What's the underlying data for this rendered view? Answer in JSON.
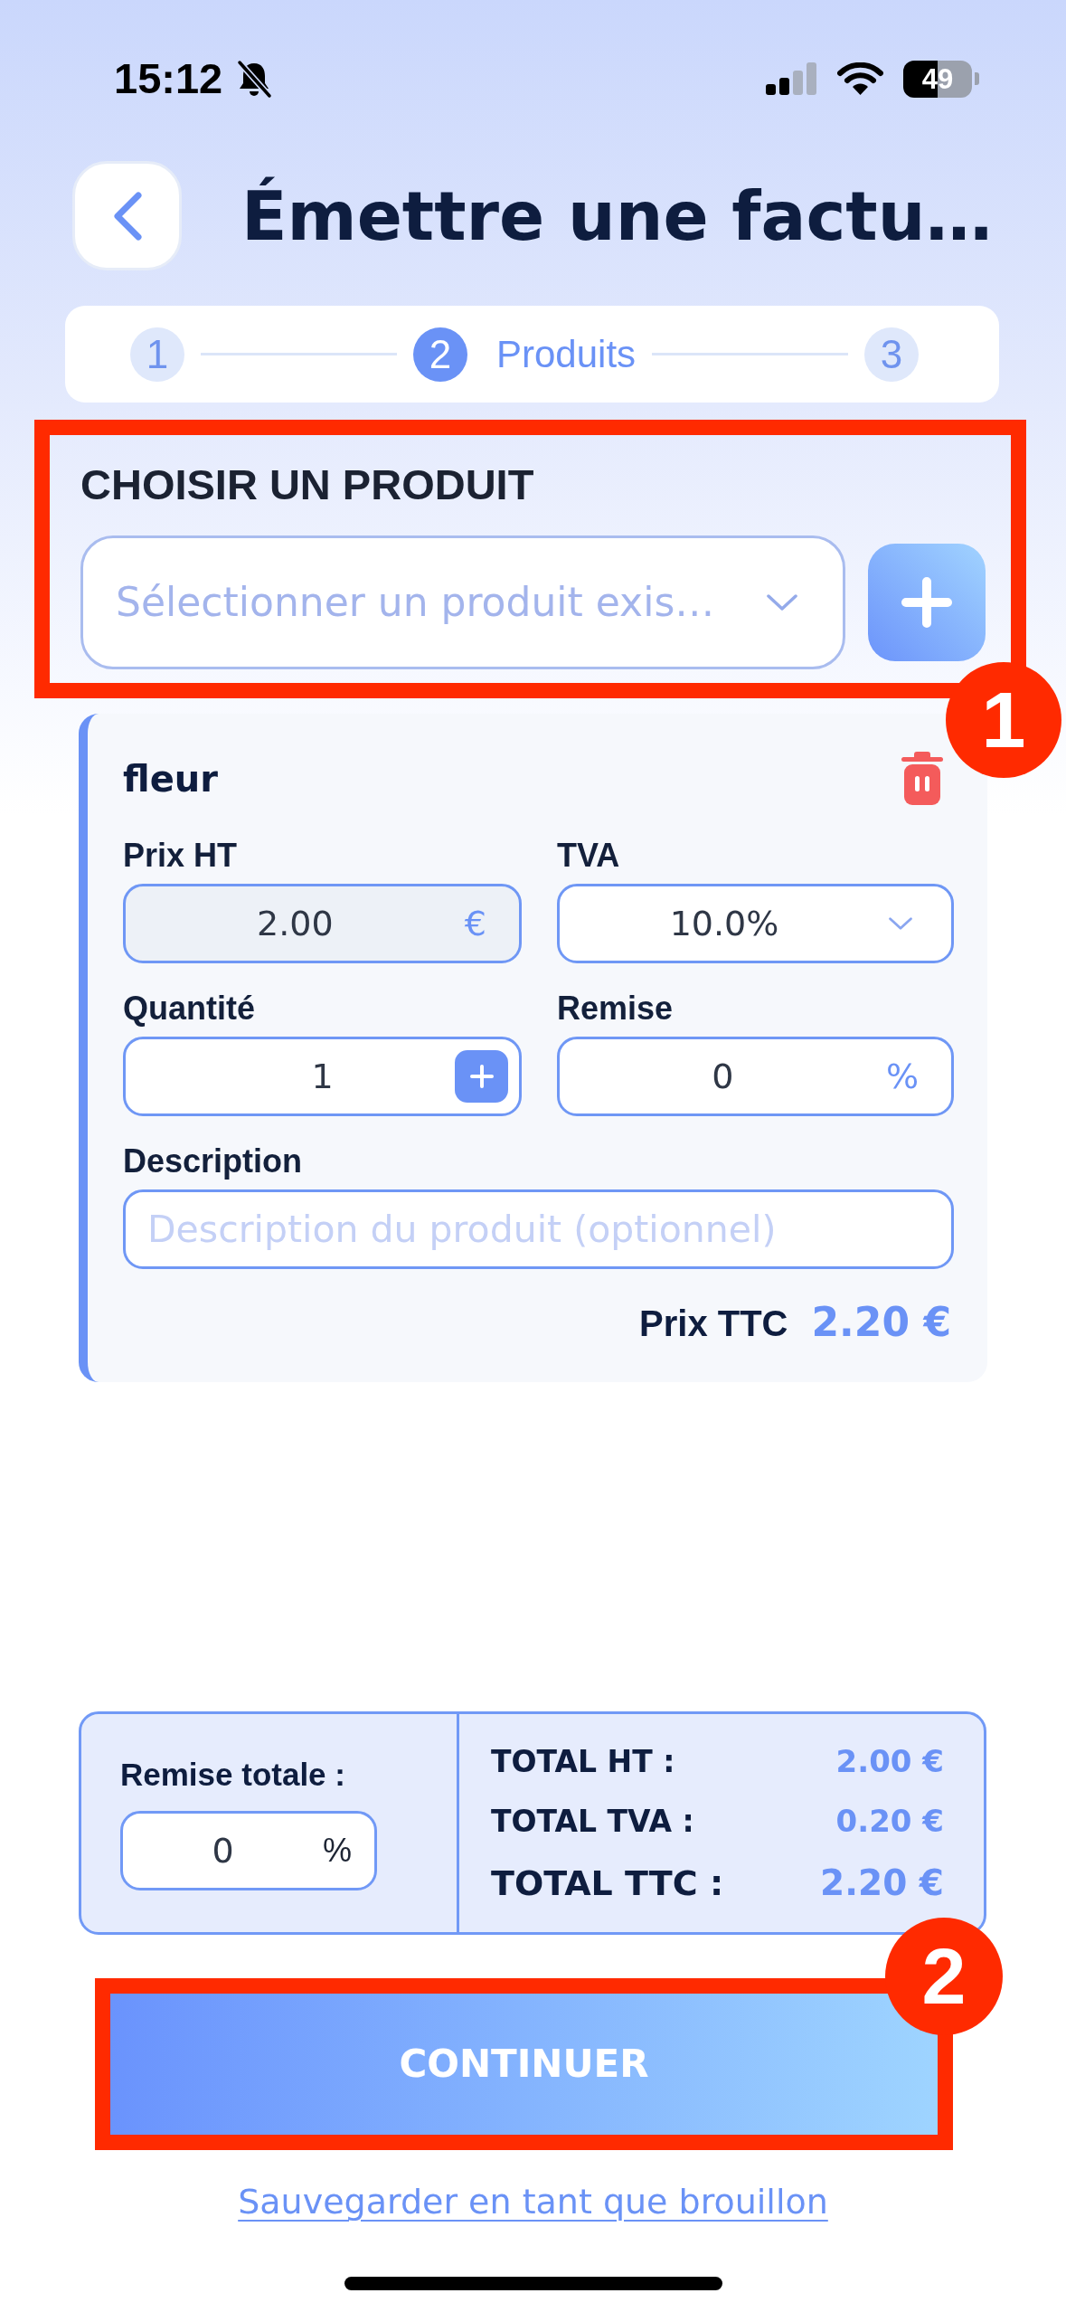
{
  "status_bar": {
    "time": "15:12",
    "battery": "49"
  },
  "header": {
    "title": "Émettre une factu…"
  },
  "stepper": [
    {
      "number": "1",
      "selected": false
    },
    {
      "number": "2",
      "label": "Produits",
      "selected": true
    },
    {
      "number": "3",
      "selected": false
    }
  ],
  "product_picker": {
    "heading": "CHOISIR UN PRODUIT",
    "placeholder": "Sélectionner un produit exis…",
    "annotation": "1"
  },
  "products": [
    {
      "name": "fleur",
      "field_rows": [
        [
          {
            "kind": "amount",
            "label": "Prix HT",
            "value": "2.00",
            "suffix": "€",
            "disabled": true
          },
          {
            "kind": "select",
            "label": "TVA",
            "value": "10.0%",
            "disabled": false
          }
        ],
        [
          {
            "kind": "quantity",
            "label": "Quantité",
            "value": "1",
            "disabled": false
          },
          {
            "kind": "amount",
            "label": "Remise",
            "value": "0",
            "suffix": "%",
            "disabled": false
          }
        ]
      ],
      "description": {
        "label": "Description",
        "placeholder": "Description du produit (optionnel)"
      },
      "price_label": "Prix TTC",
      "price_value": "2.20 €"
    }
  ],
  "totals": {
    "discount": {
      "label": "Remise totale :",
      "value": "0",
      "suffix": "%"
    },
    "rows": [
      {
        "label": "TOTAL HT :",
        "value": "2.00 €",
        "emphasis": false
      },
      {
        "label": "TOTAL TVA :",
        "value": "0.20 €",
        "emphasis": false
      },
      {
        "label": "TOTAL TTC :",
        "value": "2.20 €",
        "emphasis": true
      }
    ]
  },
  "continue_button": {
    "label": "CONTINUER",
    "annotation": "2"
  },
  "draft_link": "Sauvegarder en tant que brouillon"
}
